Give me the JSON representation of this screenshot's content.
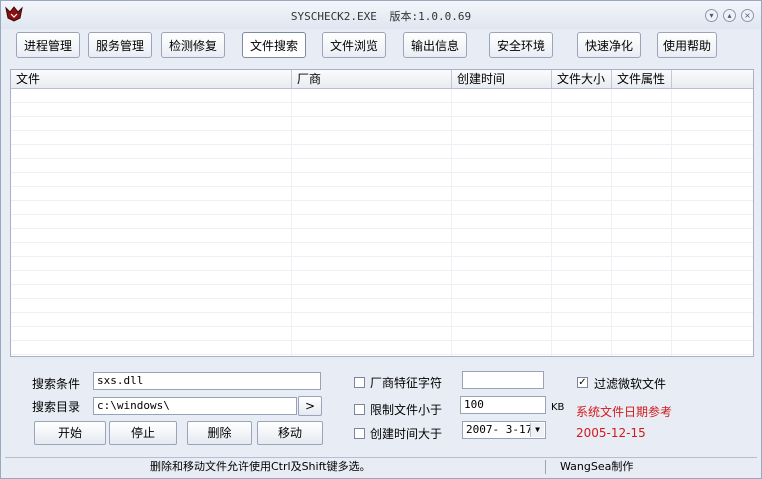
{
  "window": {
    "title_name": "SYSCHECK2.EXE",
    "title_version": "版本:1.0.0.69"
  },
  "toolbar": {
    "buttons": [
      "进程管理",
      "服务管理",
      "检测修复",
      "文件搜索",
      "文件浏览",
      "输出信息",
      "安全环境",
      "快速净化",
      "使用帮助"
    ]
  },
  "list": {
    "columns": [
      "文件",
      "厂商",
      "创建时间",
      "文件大小",
      "文件属性"
    ]
  },
  "search": {
    "cond_label": "搜索条件",
    "cond_value": "sxs.dll",
    "dir_label": "搜索目录",
    "dir_value": "c:\\windows\\",
    "browse_label": ">",
    "start_label": "开始",
    "stop_label": "停止",
    "delete_label": "删除",
    "move_label": "移动"
  },
  "options": {
    "vendor_label": "厂商特征字符",
    "vendor_value": "",
    "size_label": "限制文件小于",
    "size_value": "100",
    "size_unit": "KB",
    "date_label": "创建时间大于",
    "date_value": "2007- 3-17",
    "filter_ms_label": "过滤微软文件",
    "filter_ms_checked": "✓",
    "ref_label": "系统文件日期参考",
    "ref_date": "2005-12-15"
  },
  "statusbar": {
    "hint": "删除和移动文件允许使用Ctrl及Shift键多选。",
    "author": "WangSea制作"
  },
  "colors": {
    "accent_red": "#d11a1a",
    "window_bg": "#e8edf5"
  }
}
